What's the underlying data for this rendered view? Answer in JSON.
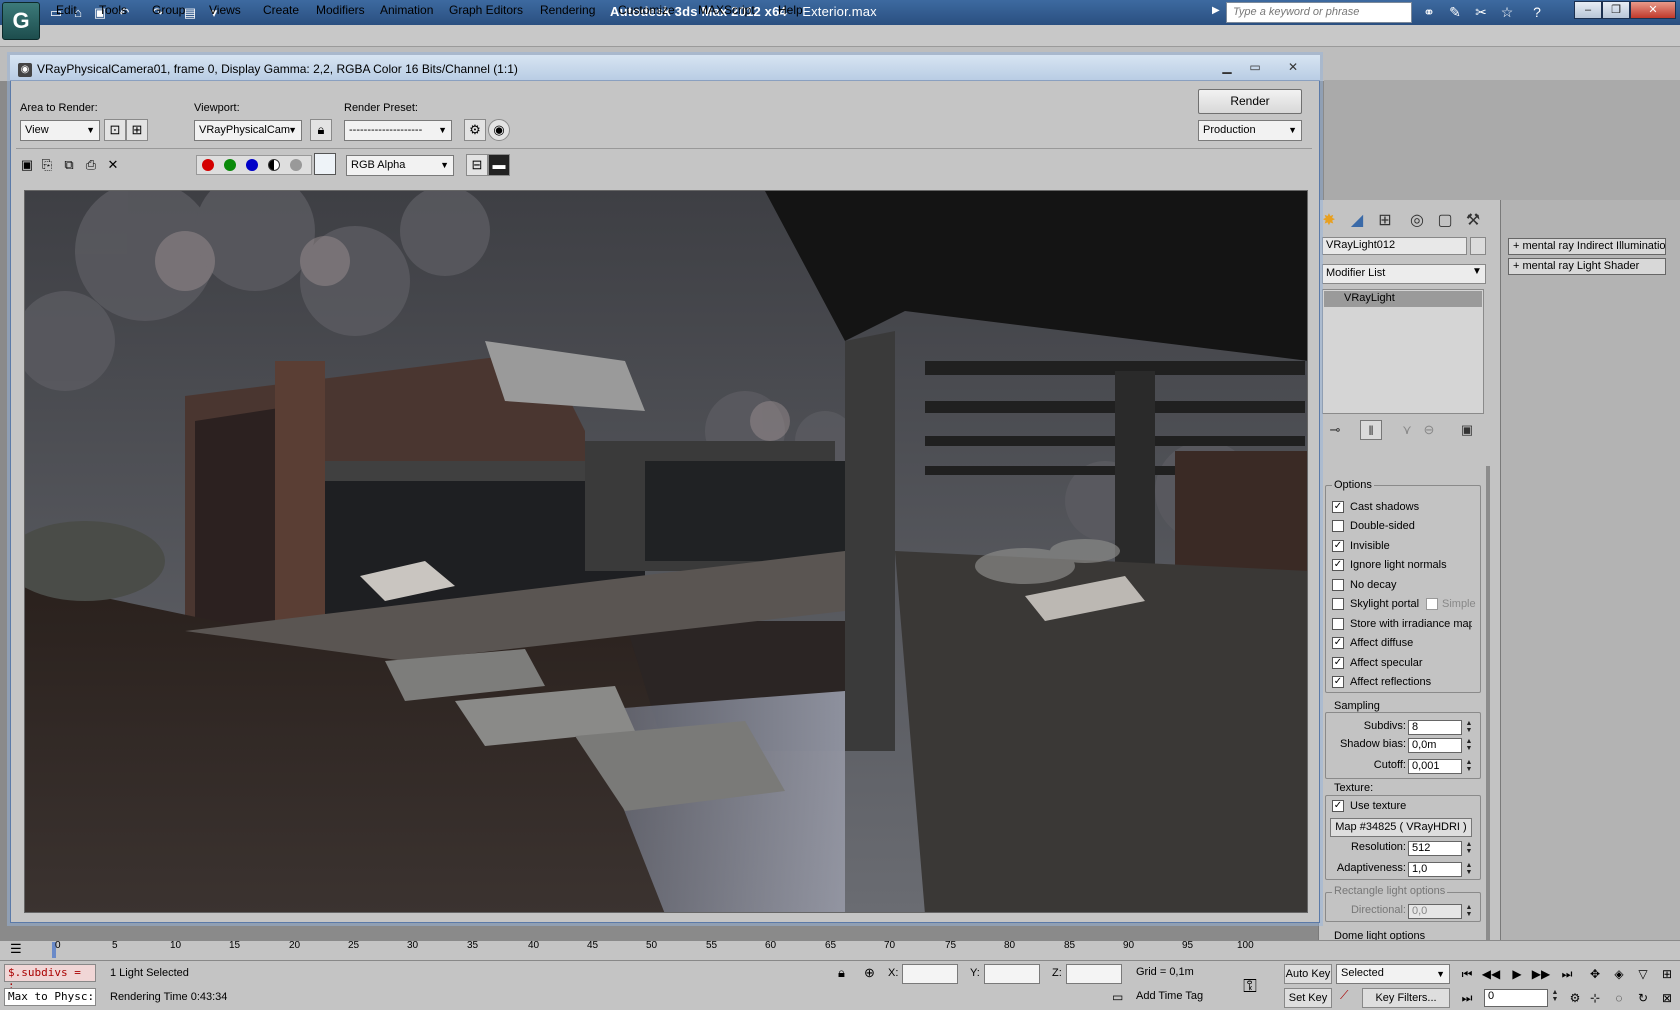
{
  "app": {
    "title": "Autodesk 3ds Max  2012 x64",
    "file": "Exterior.max",
    "logo": "G",
    "search_placeholder": "Type a keyword or phrase"
  },
  "menu": [
    "Edit",
    "Tools",
    "Group",
    "Views",
    "Create",
    "Modifiers",
    "Animation",
    "Graph Editors",
    "Rendering",
    "Customize",
    "MAXScript",
    "Help"
  ],
  "render_window": {
    "title": "VRayPhysicalCamera01, frame 0, Display Gamma: 2,2, RGBA Color 16 Bits/Channel (1:1)",
    "area_label": "Area to Render:",
    "area_value": "View",
    "viewport_label": "Viewport:",
    "viewport_value": "VRayPhysicalCam",
    "preset_label": "Render Preset:",
    "preset_value": "--------------------",
    "render_button": "Render",
    "production_value": "Production",
    "channel_value": "RGB Alpha"
  },
  "command_panel": {
    "object_name": "VRayLight012",
    "modifier_list": "Modifier List",
    "stack_item": "VRayLight",
    "options_title": "Options",
    "options": [
      {
        "label": "Cast shadows",
        "checked": true
      },
      {
        "label": "Double-sided",
        "checked": false
      },
      {
        "label": "Invisible",
        "checked": true
      },
      {
        "label": "Ignore light normals",
        "checked": true
      },
      {
        "label": "No decay",
        "checked": false
      },
      {
        "label": "Skylight portal",
        "checked": false
      },
      {
        "label": "Store with irradiance map",
        "checked": false
      },
      {
        "label": "Affect diffuse",
        "checked": true
      },
      {
        "label": "Affect specular",
        "checked": true
      },
      {
        "label": "Affect reflections",
        "checked": true
      }
    ],
    "simple_label": "Simple",
    "sampling_title": "Sampling",
    "subdivs_label": "Subdivs:",
    "subdivs_value": "8",
    "shadow_bias_label": "Shadow bias:",
    "shadow_bias_value": "0,0m",
    "cutoff_label": "Cutoff:",
    "cutoff_value": "0,001",
    "texture_title": "Texture:",
    "use_texture_label": "Use texture",
    "map_button": "Map #34825  ( VRayHDRI )",
    "resolution_label": "Resolution:",
    "resolution_value": "512",
    "adaptiveness_label": "Adaptiveness:",
    "adaptiveness_value": "1,0",
    "rect_title": "Rectangle light options",
    "directional_label": "Directional:",
    "directional_value": "0,0",
    "dome_title": "Dome light options"
  },
  "rollout_panel": [
    "mental ray Indirect Illumination",
    "mental ray Light Shader"
  ],
  "timeline": {
    "ticks": [
      "0",
      "5",
      "10",
      "15",
      "20",
      "25",
      "30",
      "35",
      "40",
      "45",
      "50",
      "55",
      "60",
      "65",
      "70",
      "75",
      "80",
      "85",
      "90",
      "95",
      "100"
    ]
  },
  "status": {
    "maxscript_line1": "$.subdivs = :",
    "maxscript_line2": "Max to Physc:",
    "selection": "1 Light Selected",
    "render_time": "Rendering Time  0:43:34",
    "x_label": "X:",
    "y_label": "Y:",
    "z_label": "Z:",
    "grid": "Grid = 0,1m",
    "add_time_tag": "Add Time Tag",
    "auto_key": "Auto Key",
    "set_key": "Set Key",
    "selected_value": "Selected",
    "key_filters": "Key Filters...",
    "frame_value": "0"
  }
}
